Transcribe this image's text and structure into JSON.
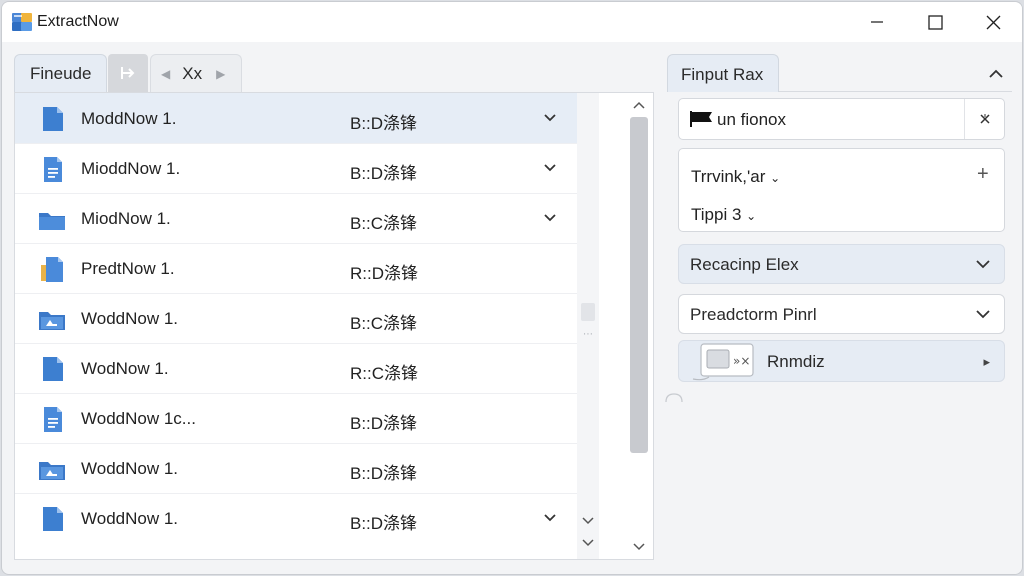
{
  "window": {
    "title": "ExtractNow",
    "controls": {
      "minimize": "minimize",
      "maximize": "maximize",
      "close": "close"
    }
  },
  "left_panel": {
    "tabs": [
      {
        "label": "Fineude",
        "active": true
      },
      {
        "label": "Xx",
        "active": false
      }
    ],
    "rows": [
      {
        "name": "ModdNow 1.",
        "dest": "B::D涤锋",
        "icon": "document-icon",
        "has_chevron": true,
        "selected": true
      },
      {
        "name": "MioddNow 1.",
        "dest": "B::D涤锋",
        "icon": "document-lines-icon",
        "has_chevron": true,
        "selected": false
      },
      {
        "name": "MiodNow 1.",
        "dest": "B::C涤锋",
        "icon": "folder-icon",
        "has_chevron": true,
        "selected": false
      },
      {
        "name": "PredtNow 1.",
        "dest": "R::D涤锋",
        "icon": "document-folder-icon",
        "has_chevron": false,
        "selected": false
      },
      {
        "name": "WoddNow 1.",
        "dest": "B::C涤锋",
        "icon": "folder-image-icon",
        "has_chevron": false,
        "selected": false
      },
      {
        "name": "WodNow 1.",
        "dest": "R::C涤锋",
        "icon": "document-icon",
        "has_chevron": false,
        "selected": false
      },
      {
        "name": "WoddNow 1c...",
        "dest": "B::D涤锋",
        "icon": "document-lines-icon",
        "has_chevron": false,
        "selected": false
      },
      {
        "name": "WoddNow 1.",
        "dest": "B::D涤锋",
        "icon": "folder-image-icon",
        "has_chevron": false,
        "selected": false
      },
      {
        "name": "WoddNow 1.",
        "dest": "B::D涤锋",
        "icon": "document-icon",
        "has_chevron": true,
        "selected": false
      }
    ]
  },
  "right_panel": {
    "tab_label": "Finput Rax",
    "input": {
      "value": "un fionox"
    },
    "options": {
      "option1": "Trrvink,'ar",
      "option2": "Tippi 3"
    },
    "dropdown1": "Recacinp Elex",
    "dropdown2": "Preadctorm Pinrl",
    "run_label": "Rnmdiz"
  },
  "colors": {
    "accent_blue": "#3d7fd0",
    "selected_row": "#e6edf6",
    "tab_active": "#e6ecf4"
  }
}
